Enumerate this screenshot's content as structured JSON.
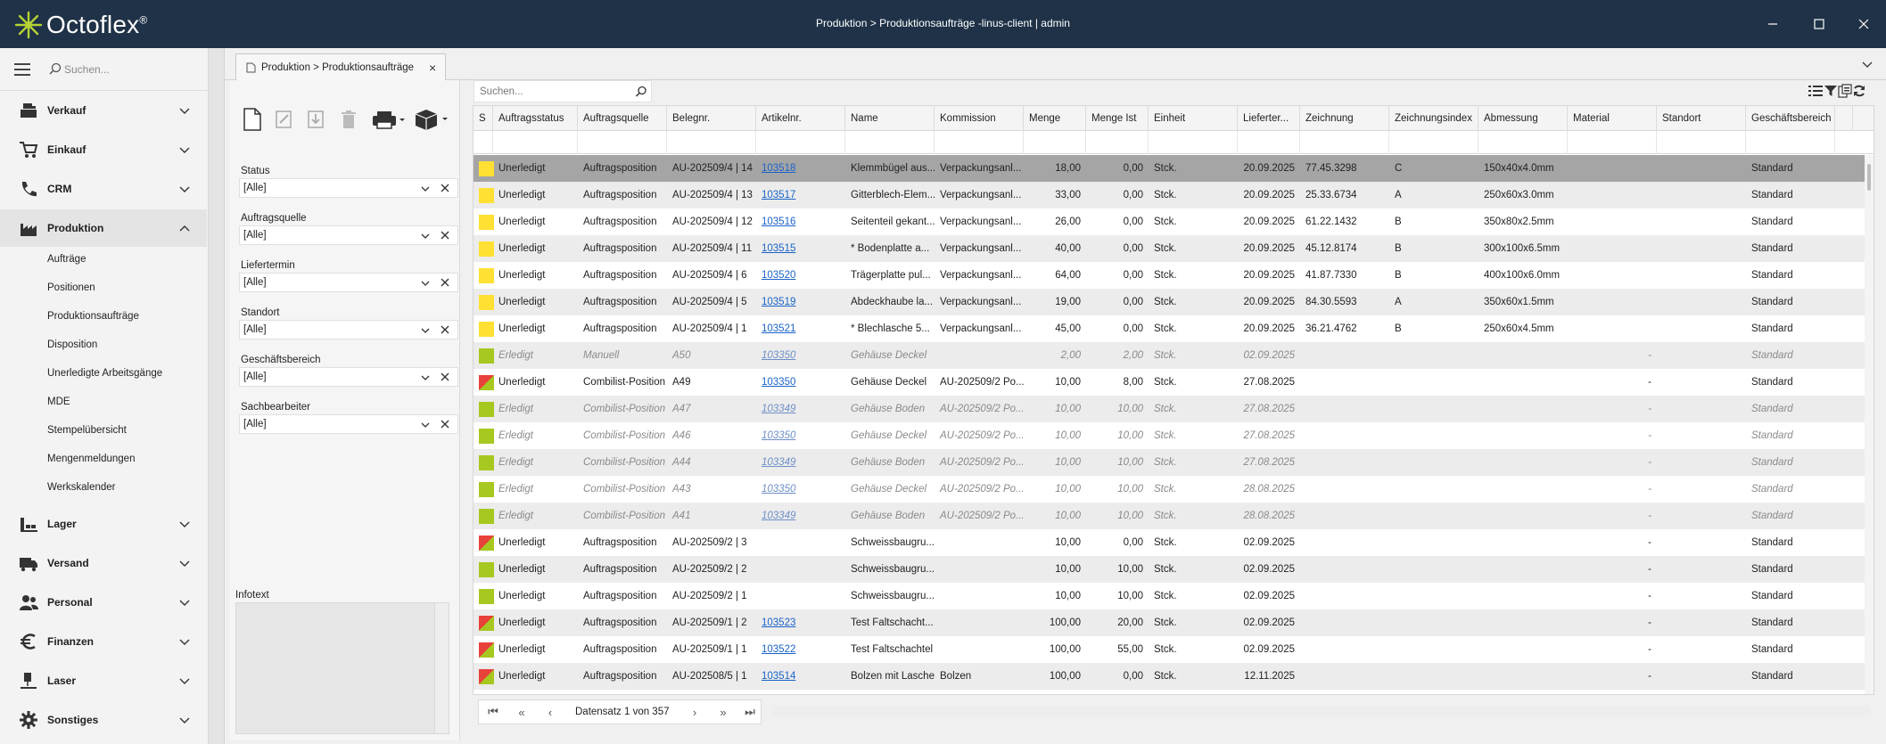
{
  "app": {
    "name": "Octoflex",
    "trademark": "®",
    "window_title": "Produktion > Produktionsaufträge -linus-client | admin"
  },
  "sidebar": {
    "search_placeholder": "Suchen...",
    "items": [
      {
        "label": "Verkauf",
        "icon": "cash-register-icon"
      },
      {
        "label": "Einkauf",
        "icon": "shopping-cart-icon"
      },
      {
        "label": "CRM",
        "icon": "phone-icon"
      },
      {
        "label": "Produktion",
        "icon": "factory-icon",
        "expanded": true
      },
      {
        "label": "Lager",
        "icon": "warehouse-icon"
      },
      {
        "label": "Versand",
        "icon": "truck-icon"
      },
      {
        "label": "Personal",
        "icon": "people-icon"
      },
      {
        "label": "Finanzen",
        "icon": "euro-icon"
      },
      {
        "label": "Laser",
        "icon": "laser-icon"
      },
      {
        "label": "Sonstiges",
        "icon": "gear-icon"
      }
    ],
    "produktion_sub": [
      "Aufträge",
      "Positionen",
      "Produktionsaufträge",
      "Disposition",
      "Unerledigte Arbeitsgänge",
      "MDE",
      "Stempelübersicht",
      "Mengenmeldungen",
      "Werkskalender"
    ]
  },
  "tab": {
    "label": "Produktion > Produktionsaufträge"
  },
  "filters": [
    {
      "label": "Status",
      "value": "[Alle]"
    },
    {
      "label": "Auftragsquelle",
      "value": "[Alle]"
    },
    {
      "label": "Liefertermin",
      "value": "[Alle]"
    },
    {
      "label": "Standort",
      "value": "[Alle]"
    },
    {
      "label": "Geschäftsbereich",
      "value": "[Alle]"
    },
    {
      "label": "Sachbearbeiter",
      "value": "[Alle]"
    }
  ],
  "infotext_label": "Infotext",
  "grid": {
    "search_placeholder": "Suchen...",
    "columns": [
      "S",
      "Auftragsstatus",
      "Auftragsquelle",
      "Belegnr.",
      "Artikelnr.",
      "Name",
      "Kommission",
      "Menge",
      "Menge Ist",
      "Einheit",
      "Lieferter...",
      "Zeichnung",
      "Zeichnungsindex",
      "Abmessung",
      "Material",
      "Standort",
      "Geschäftsbereich"
    ],
    "status_colors": {
      "yellow": "#ffe033",
      "green": "#a6c820",
      "red": "#e8413a"
    },
    "rows": [
      {
        "s": "yellow",
        "status": "Unerledigt",
        "quelle": "Auftragsposition",
        "beleg": "AU-202509/4 | 14",
        "artikel": "103518",
        "name": "Klemmbügel aus...",
        "kommission": "Verpackungsanl...",
        "menge": "18,00",
        "ist": "0,00",
        "einheit": "Stck.",
        "liefer": "20.09.2025",
        "zeichnung": "77.45.3298",
        "zidx": "C",
        "abm": "150x40x4.0mm",
        "material": "",
        "standort": "",
        "gb": "Standard",
        "selected": true
      },
      {
        "s": "yellow",
        "status": "Unerledigt",
        "quelle": "Auftragsposition",
        "beleg": "AU-202509/4 | 13",
        "artikel": "103517",
        "name": "Gitterblech-Elem...",
        "kommission": "Verpackungsanl...",
        "menge": "33,00",
        "ist": "0,00",
        "einheit": "Stck.",
        "liefer": "20.09.2025",
        "zeichnung": "25.33.6734",
        "zidx": "A",
        "abm": "250x60x3.0mm",
        "material": "",
        "standort": "",
        "gb": "Standard"
      },
      {
        "s": "yellow",
        "status": "Unerledigt",
        "quelle": "Auftragsposition",
        "beleg": "AU-202509/4 | 12",
        "artikel": "103516",
        "name": "Seitenteil gekant...",
        "kommission": "Verpackungsanl...",
        "menge": "26,00",
        "ist": "0,00",
        "einheit": "Stck.",
        "liefer": "20.09.2025",
        "zeichnung": "61.22.1432",
        "zidx": "B",
        "abm": "350x80x2.5mm",
        "material": "",
        "standort": "",
        "gb": "Standard"
      },
      {
        "s": "yellow",
        "status": "Unerledigt",
        "quelle": "Auftragsposition",
        "beleg": "AU-202509/4 | 11",
        "artikel": "103515",
        "name": "* Bodenplatte a...",
        "kommission": "Verpackungsanl...",
        "menge": "40,00",
        "ist": "0,00",
        "einheit": "Stck.",
        "liefer": "20.09.2025",
        "zeichnung": "45.12.8174",
        "zidx": "B",
        "abm": "300x100x6.5mm",
        "material": "",
        "standort": "",
        "gb": "Standard"
      },
      {
        "s": "yellow",
        "status": "Unerledigt",
        "quelle": "Auftragsposition",
        "beleg": "AU-202509/4 | 6",
        "artikel": "103520",
        "name": "Trägerplatte pul...",
        "kommission": "Verpackungsanl...",
        "menge": "64,00",
        "ist": "0,00",
        "einheit": "Stck.",
        "liefer": "20.09.2025",
        "zeichnung": "41.87.7330",
        "zidx": "B",
        "abm": "400x100x6.0mm",
        "material": "",
        "standort": "",
        "gb": "Standard"
      },
      {
        "s": "yellow",
        "status": "Unerledigt",
        "quelle": "Auftragsposition",
        "beleg": "AU-202509/4 | 5",
        "artikel": "103519",
        "name": "Abdeckhaube la...",
        "kommission": "Verpackungsanl...",
        "menge": "19,00",
        "ist": "0,00",
        "einheit": "Stck.",
        "liefer": "20.09.2025",
        "zeichnung": "84.30.5593",
        "zidx": "A",
        "abm": "350x60x1.5mm",
        "material": "",
        "standort": "",
        "gb": "Standard"
      },
      {
        "s": "yellow",
        "status": "Unerledigt",
        "quelle": "Auftragsposition",
        "beleg": "AU-202509/4 | 1",
        "artikel": "103521",
        "name": "* Blechlasche 5...",
        "kommission": "Verpackungsanl...",
        "menge": "45,00",
        "ist": "0,00",
        "einheit": "Stck.",
        "liefer": "20.09.2025",
        "zeichnung": "36.21.4762",
        "zidx": "B",
        "abm": "250x60x4.5mm",
        "material": "",
        "standort": "",
        "gb": "Standard"
      },
      {
        "s": "green",
        "status": "Erledigt",
        "quelle": "Manuell",
        "beleg": "A50",
        "artikel": "103350",
        "name": "Gehäuse Deckel",
        "kommission": "",
        "menge": "2,00",
        "ist": "2,00",
        "einheit": "Stck.",
        "liefer": "02.09.2025",
        "zeichnung": "",
        "zidx": "",
        "abm": "",
        "material": "-",
        "standort": "",
        "gb": "Standard",
        "done": true
      },
      {
        "s": "mixed",
        "status": "Unerledigt",
        "quelle": "Combilist-Position",
        "beleg": "A49",
        "artikel": "103350",
        "name": "Gehäuse Deckel",
        "kommission": "AU-202509/2 Po...",
        "menge": "10,00",
        "ist": "8,00",
        "einheit": "Stck.",
        "liefer": "27.08.2025",
        "zeichnung": "",
        "zidx": "",
        "abm": "",
        "material": "-",
        "standort": "",
        "gb": "Standard"
      },
      {
        "s": "green",
        "status": "Erledigt",
        "quelle": "Combilist-Position",
        "beleg": "A47",
        "artikel": "103349",
        "name": "Gehäuse Boden",
        "kommission": "AU-202509/2 Po...",
        "menge": "10,00",
        "ist": "10,00",
        "einheit": "Stck.",
        "liefer": "27.08.2025",
        "zeichnung": "",
        "zidx": "",
        "abm": "",
        "material": "-",
        "standort": "",
        "gb": "Standard",
        "done": true
      },
      {
        "s": "green",
        "status": "Erledigt",
        "quelle": "Combilist-Position",
        "beleg": "A46",
        "artikel": "103350",
        "name": "Gehäuse Deckel",
        "kommission": "AU-202509/2 Po...",
        "menge": "10,00",
        "ist": "10,00",
        "einheit": "Stck.",
        "liefer": "27.08.2025",
        "zeichnung": "",
        "zidx": "",
        "abm": "",
        "material": "-",
        "standort": "",
        "gb": "Standard",
        "done": true
      },
      {
        "s": "green",
        "status": "Erledigt",
        "quelle": "Combilist-Position",
        "beleg": "A44",
        "artikel": "103349",
        "name": "Gehäuse Boden",
        "kommission": "AU-202509/2 Po...",
        "menge": "10,00",
        "ist": "10,00",
        "einheit": "Stck.",
        "liefer": "27.08.2025",
        "zeichnung": "",
        "zidx": "",
        "abm": "",
        "material": "-",
        "standort": "",
        "gb": "Standard",
        "done": true
      },
      {
        "s": "green",
        "status": "Erledigt",
        "quelle": "Combilist-Position",
        "beleg": "A43",
        "artikel": "103350",
        "name": "Gehäuse Deckel",
        "kommission": "AU-202509/2 Po...",
        "menge": "10,00",
        "ist": "10,00",
        "einheit": "Stck.",
        "liefer": "28.08.2025",
        "zeichnung": "",
        "zidx": "",
        "abm": "",
        "material": "-",
        "standort": "",
        "gb": "Standard",
        "done": true
      },
      {
        "s": "green",
        "status": "Erledigt",
        "quelle": "Combilist-Position",
        "beleg": "A41",
        "artikel": "103349",
        "name": "Gehäuse Boden",
        "kommission": "AU-202509/2 Po...",
        "menge": "10,00",
        "ist": "10,00",
        "einheit": "Stck.",
        "liefer": "28.08.2025",
        "zeichnung": "",
        "zidx": "",
        "abm": "",
        "material": "-",
        "standort": "",
        "gb": "Standard",
        "done": true
      },
      {
        "s": "mixed",
        "status": "Unerledigt",
        "quelle": "Auftragsposition",
        "beleg": "AU-202509/2 | 3",
        "artikel": "",
        "name": "Schweissbaugru...",
        "kommission": "",
        "menge": "10,00",
        "ist": "0,00",
        "einheit": "Stck.",
        "liefer": "02.09.2025",
        "zeichnung": "",
        "zidx": "",
        "abm": "",
        "material": "-",
        "standort": "",
        "gb": "Standard"
      },
      {
        "s": "green",
        "status": "Unerledigt",
        "quelle": "Auftragsposition",
        "beleg": "AU-202509/2 | 2",
        "artikel": "",
        "name": "Schweissbaugru...",
        "kommission": "",
        "menge": "10,00",
        "ist": "10,00",
        "einheit": "Stck.",
        "liefer": "02.09.2025",
        "zeichnung": "",
        "zidx": "",
        "abm": "",
        "material": "-",
        "standort": "",
        "gb": "Standard"
      },
      {
        "s": "green",
        "status": "Unerledigt",
        "quelle": "Auftragsposition",
        "beleg": "AU-202509/2 | 1",
        "artikel": "",
        "name": "Schweissbaugru...",
        "kommission": "",
        "menge": "10,00",
        "ist": "10,00",
        "einheit": "Stck.",
        "liefer": "02.09.2025",
        "zeichnung": "",
        "zidx": "",
        "abm": "",
        "material": "-",
        "standort": "",
        "gb": "Standard"
      },
      {
        "s": "mixed",
        "status": "Unerledigt",
        "quelle": "Auftragsposition",
        "beleg": "AU-202509/1 | 2",
        "artikel": "103523",
        "name": "Test Faltschacht...",
        "kommission": "",
        "menge": "100,00",
        "ist": "20,00",
        "einheit": "Stck.",
        "liefer": "02.09.2025",
        "zeichnung": "",
        "zidx": "",
        "abm": "",
        "material": "-",
        "standort": "",
        "gb": "Standard"
      },
      {
        "s": "mixed",
        "status": "Unerledigt",
        "quelle": "Auftragsposition",
        "beleg": "AU-202509/1 | 1",
        "artikel": "103522",
        "name": "Test Faltschachtel",
        "kommission": "",
        "menge": "100,00",
        "ist": "55,00",
        "einheit": "Stck.",
        "liefer": "02.09.2025",
        "zeichnung": "",
        "zidx": "",
        "abm": "",
        "material": "-",
        "standort": "",
        "gb": "Standard"
      },
      {
        "s": "mixed",
        "status": "Unerledigt",
        "quelle": "Auftragsposition",
        "beleg": "AU-202508/5 | 1",
        "artikel": "103514",
        "name": "Bolzen mit Lasche",
        "kommission": "Bolzen",
        "menge": "100,00",
        "ist": "0,00",
        "einheit": "Stck.",
        "liefer": "12.11.2025",
        "zeichnung": "",
        "zidx": "",
        "abm": "",
        "material": "-",
        "standort": "",
        "gb": "Standard"
      }
    ]
  },
  "pager": {
    "text": "Datensatz 1 von 357"
  }
}
